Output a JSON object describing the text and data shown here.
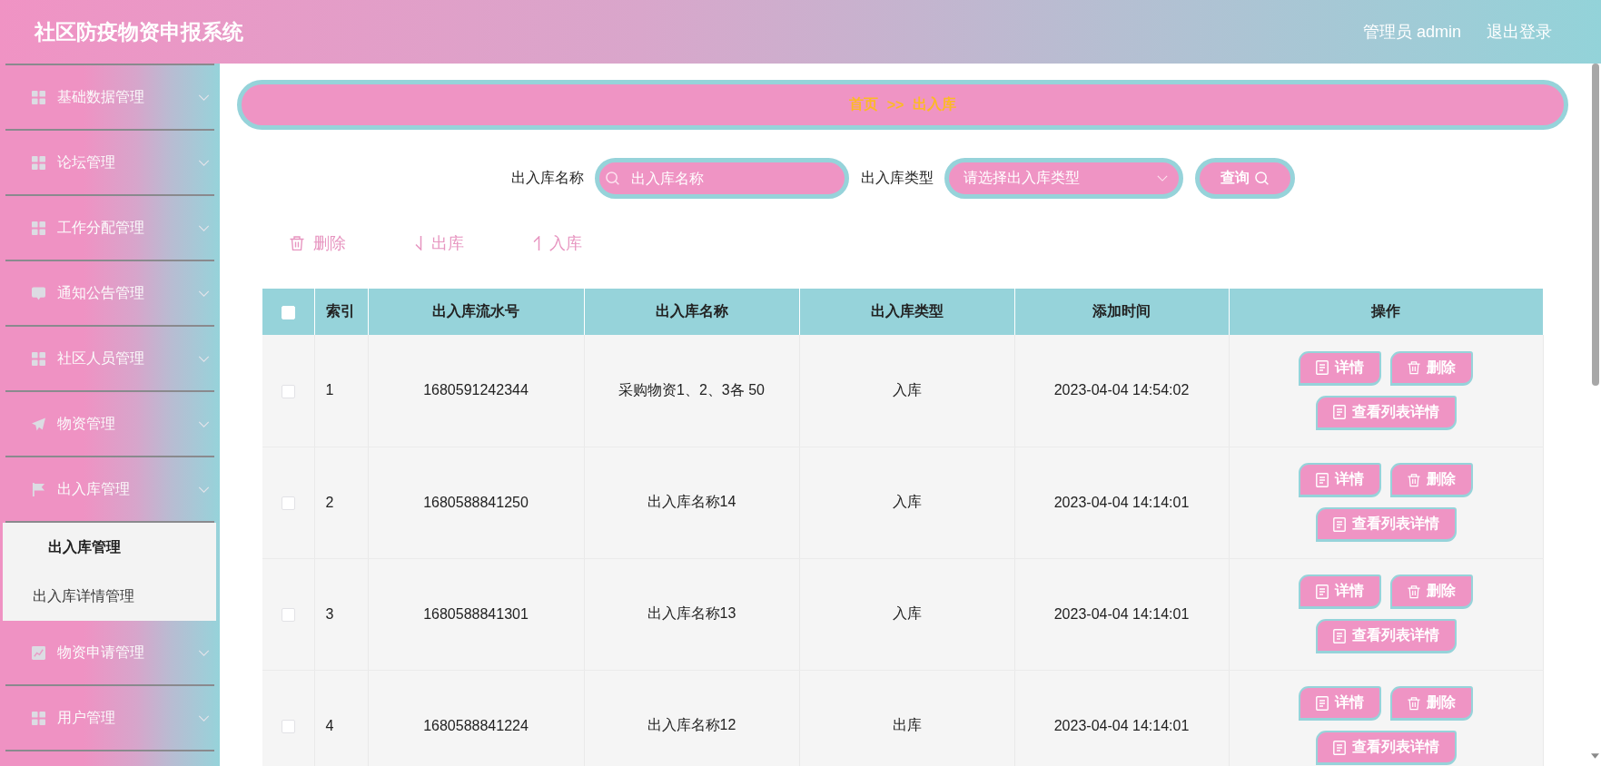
{
  "header": {
    "title": "社区防疫物资申报系统",
    "user": "管理员 admin",
    "logout": "退出登录"
  },
  "sidebar": {
    "items": [
      {
        "label": "基础数据管理"
      },
      {
        "label": "论坛管理"
      },
      {
        "label": "工作分配管理"
      },
      {
        "label": "通知公告管理"
      },
      {
        "label": "社区人员管理"
      },
      {
        "label": "物资管理"
      },
      {
        "label": "出入库管理",
        "children": [
          {
            "label": "出入库管理",
            "selected": true
          },
          {
            "label": "出入库详情管理",
            "selected": false
          }
        ]
      },
      {
        "label": "物资申请管理"
      },
      {
        "label": "用户管理"
      }
    ]
  },
  "breadcrumb": {
    "items": [
      "首页",
      "出入库"
    ],
    "separator": ">>"
  },
  "search": {
    "fields": [
      {
        "kind": "input",
        "label": "出入库名称",
        "placeholder": "出入库名称"
      },
      {
        "kind": "select",
        "label": "出入库类型",
        "placeholder": "请选择出入库类型"
      }
    ],
    "button": "查询"
  },
  "toolbar": [
    {
      "kind": "delete",
      "label": "删除"
    },
    {
      "kind": "out",
      "label": "出库"
    },
    {
      "kind": "in",
      "label": "入库"
    }
  ],
  "table": {
    "header_checkbox": {
      "checked": false
    },
    "columns": [
      "索引",
      "出入库流水号",
      "出入库名称",
      "出入库类型",
      "添加时间",
      "操作"
    ],
    "rows": [
      {
        "checked": false,
        "cells": [
          "1",
          "1680591242344",
          "采购物资1、2、3各 50",
          "入库",
          "2023-04-04 14:54:02"
        ],
        "actions": [
          {
            "kind": "detail",
            "label": "详情"
          },
          {
            "kind": "delete",
            "label": "删除"
          },
          {
            "kind": "list",
            "label": "查看列表详情"
          }
        ]
      },
      {
        "checked": false,
        "cells": [
          "2",
          "1680588841250",
          "出入库名称14",
          "入库",
          "2023-04-04 14:14:01"
        ],
        "actions": [
          {
            "kind": "detail",
            "label": "详情"
          },
          {
            "kind": "delete",
            "label": "删除"
          },
          {
            "kind": "list",
            "label": "查看列表详情"
          }
        ]
      },
      {
        "checked": false,
        "cells": [
          "3",
          "1680588841301",
          "出入库名称13",
          "入库",
          "2023-04-04 14:14:01"
        ],
        "actions": [
          {
            "kind": "detail",
            "label": "详情"
          },
          {
            "kind": "delete",
            "label": "删除"
          },
          {
            "kind": "list",
            "label": "查看列表详情"
          }
        ]
      },
      {
        "checked": false,
        "cells": [
          "4",
          "1680588841224",
          "出入库名称12",
          "出库",
          "2023-04-04 14:14:01"
        ],
        "actions": [
          {
            "kind": "detail",
            "label": "详情"
          },
          {
            "kind": "delete",
            "label": "删除"
          },
          {
            "kind": "list",
            "label": "查看列表详情"
          }
        ]
      }
    ]
  }
}
